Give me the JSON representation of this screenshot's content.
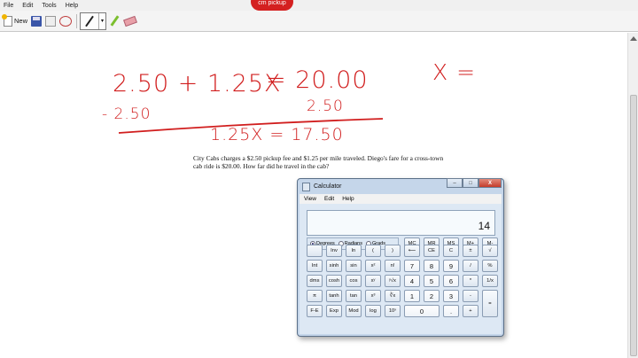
{
  "menu": [
    "File",
    "Edit",
    "Tools",
    "Help"
  ],
  "badge_label": "cm pickup",
  "toolbar": {
    "new_label": "New"
  },
  "math": {
    "eq1_left": "2.50 + 1.25X",
    "eq1_right": "= 20.00",
    "sub_left": "- 2.50",
    "sub_right": "2.50",
    "eq2": "1.25X = 17.50",
    "answer": "X ="
  },
  "word_problem": "City Cabs charges a $2.50 pickup fee and $1.25 per mile traveled. Diego's fare for a cross-town cab ride is $20.00. How far did he travel in the cab?",
  "calculator": {
    "title": "Calculator",
    "menu": [
      "View",
      "Edit",
      "Help"
    ],
    "display": "14",
    "window_buttons": {
      "minimize": "–",
      "maximize": "□",
      "close": "X"
    },
    "angle_modes": [
      {
        "label": "Degrees",
        "selected": true
      },
      {
        "label": "Radians",
        "selected": false
      },
      {
        "label": "Grads",
        "selected": false
      }
    ],
    "memory_keys": [
      "MC",
      "MR",
      "MS",
      "M+",
      "M-"
    ],
    "rows": [
      [
        "",
        "Inv",
        "ln",
        "(",
        ")",
        "⟵",
        "CE",
        "C",
        "±",
        "√"
      ],
      [
        "Int",
        "sinh",
        "sin",
        "x²",
        "n!",
        "7",
        "8",
        "9",
        "/",
        "%"
      ],
      [
        "dms",
        "cosh",
        "cos",
        "xʸ",
        "ʸ√x",
        "4",
        "5",
        "6",
        "*",
        "1/x"
      ],
      [
        "π",
        "tanh",
        "tan",
        "x³",
        "∛x",
        "1",
        "2",
        "3",
        "-",
        ""
      ],
      [
        "F-E",
        "Exp",
        "Mod",
        "log",
        "10ˣ",
        "0",
        "",
        ".",
        "+",
        ""
      ]
    ],
    "equals": "="
  }
}
